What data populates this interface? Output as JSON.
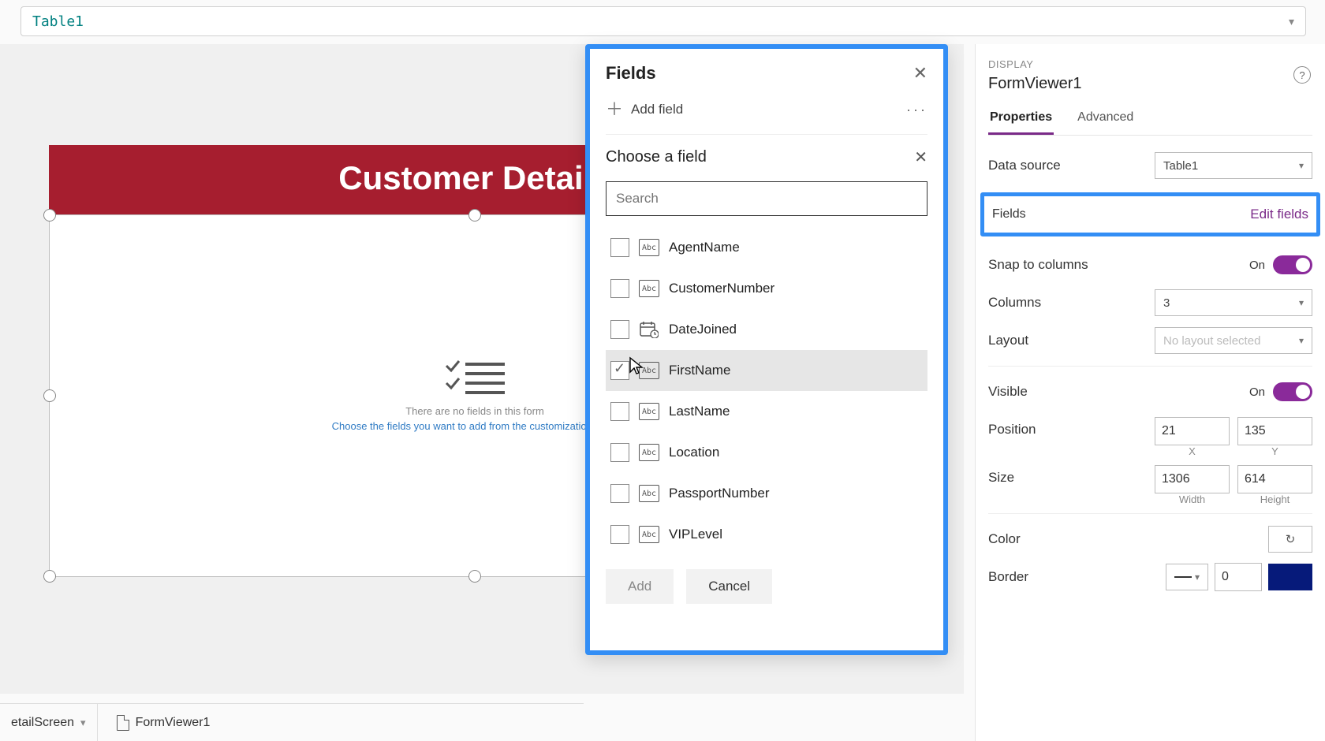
{
  "formula_bar": {
    "value": "Table1"
  },
  "form": {
    "header": "Customer Details",
    "empty_line1": "There are no fields in this form",
    "empty_line2": "Choose the fields you want to add from the customization pane"
  },
  "fields_panel": {
    "title": "Fields",
    "add_field": "Add field",
    "choose_title": "Choose a field",
    "search_placeholder": "Search",
    "items": [
      {
        "label": "AgentName",
        "type": "Abc"
      },
      {
        "label": "CustomerNumber",
        "type": "Abc"
      },
      {
        "label": "DateJoined",
        "type": "date"
      },
      {
        "label": "FirstName",
        "type": "Abc"
      },
      {
        "label": "LastName",
        "type": "Abc"
      },
      {
        "label": "Location",
        "type": "Abc"
      },
      {
        "label": "PassportNumber",
        "type": "Abc"
      },
      {
        "label": "VIPLevel",
        "type": "Abc"
      }
    ],
    "add_btn": "Add",
    "cancel_btn": "Cancel"
  },
  "props": {
    "section": "DISPLAY",
    "object": "FormViewer1",
    "tabs": {
      "properties": "Properties",
      "advanced": "Advanced"
    },
    "data_source_label": "Data source",
    "data_source_value": "Table1",
    "fields_label": "Fields",
    "edit_fields": "Edit fields",
    "snap_label": "Snap to columns",
    "snap_value": "On",
    "columns_label": "Columns",
    "columns_value": "3",
    "layout_label": "Layout",
    "layout_value": "No layout selected",
    "visible_label": "Visible",
    "visible_value": "On",
    "position_label": "Position",
    "pos_x": "21",
    "pos_y": "135",
    "pos_x_lbl": "X",
    "pos_y_lbl": "Y",
    "size_label": "Size",
    "size_w": "1306",
    "size_h": "614",
    "size_w_lbl": "Width",
    "size_h_lbl": "Height",
    "color_label": "Color",
    "border_label": "Border",
    "border_value": "0"
  },
  "breadcrumb": {
    "item1": "etailScreen",
    "item2": "FormViewer1"
  }
}
